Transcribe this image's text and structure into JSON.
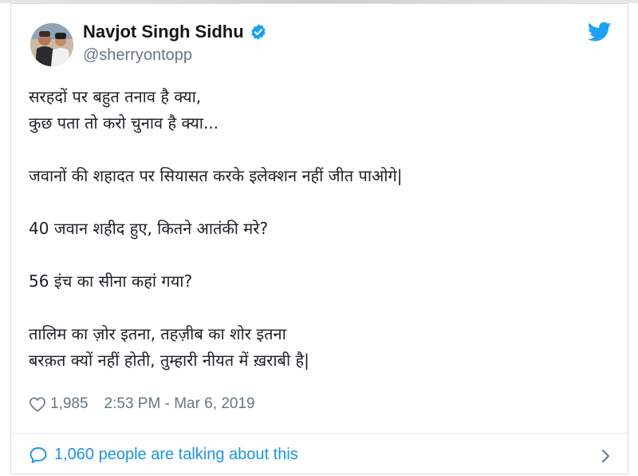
{
  "tweet": {
    "author_name": "Navjot Singh Sidhu",
    "handle": "@sherryontopp",
    "verified": true,
    "lines": [
      "सरहदों पर बहुत तनाव है क्या,",
      "कुछ पता तो करो चुनाव है क्या...",
      "",
      "जवानों की शहादत पर सियासत करके इलेक्शन नहीं जीत पाओगे|",
      "",
      "40 जवान शहीद हुए, कितने आतंकी मरे?",
      "",
      "56 इंच का सीना कहां गया?",
      "",
      "तालिम का ज़ोर इतना, तहज़ीब का शोर इतना",
      "बरक़त क्यों नहीं होती, तुम्हारी नीयत में ख़राबी है|"
    ],
    "likes": "1,985",
    "timestamp": "2:53 PM - Mar 6, 2019"
  },
  "footer": {
    "talking_label": "1,060 people are talking about this"
  },
  "colors": {
    "accent": "#1b95e0",
    "twitter_blue": "#1da1f2",
    "muted": "#657786",
    "text": "#14171a"
  },
  "icons": {
    "verified": "verified-badge-icon",
    "brand": "twitter-bird-icon",
    "like": "heart-icon",
    "reply": "chat-bubble-icon",
    "more": "chevron-right-icon"
  }
}
